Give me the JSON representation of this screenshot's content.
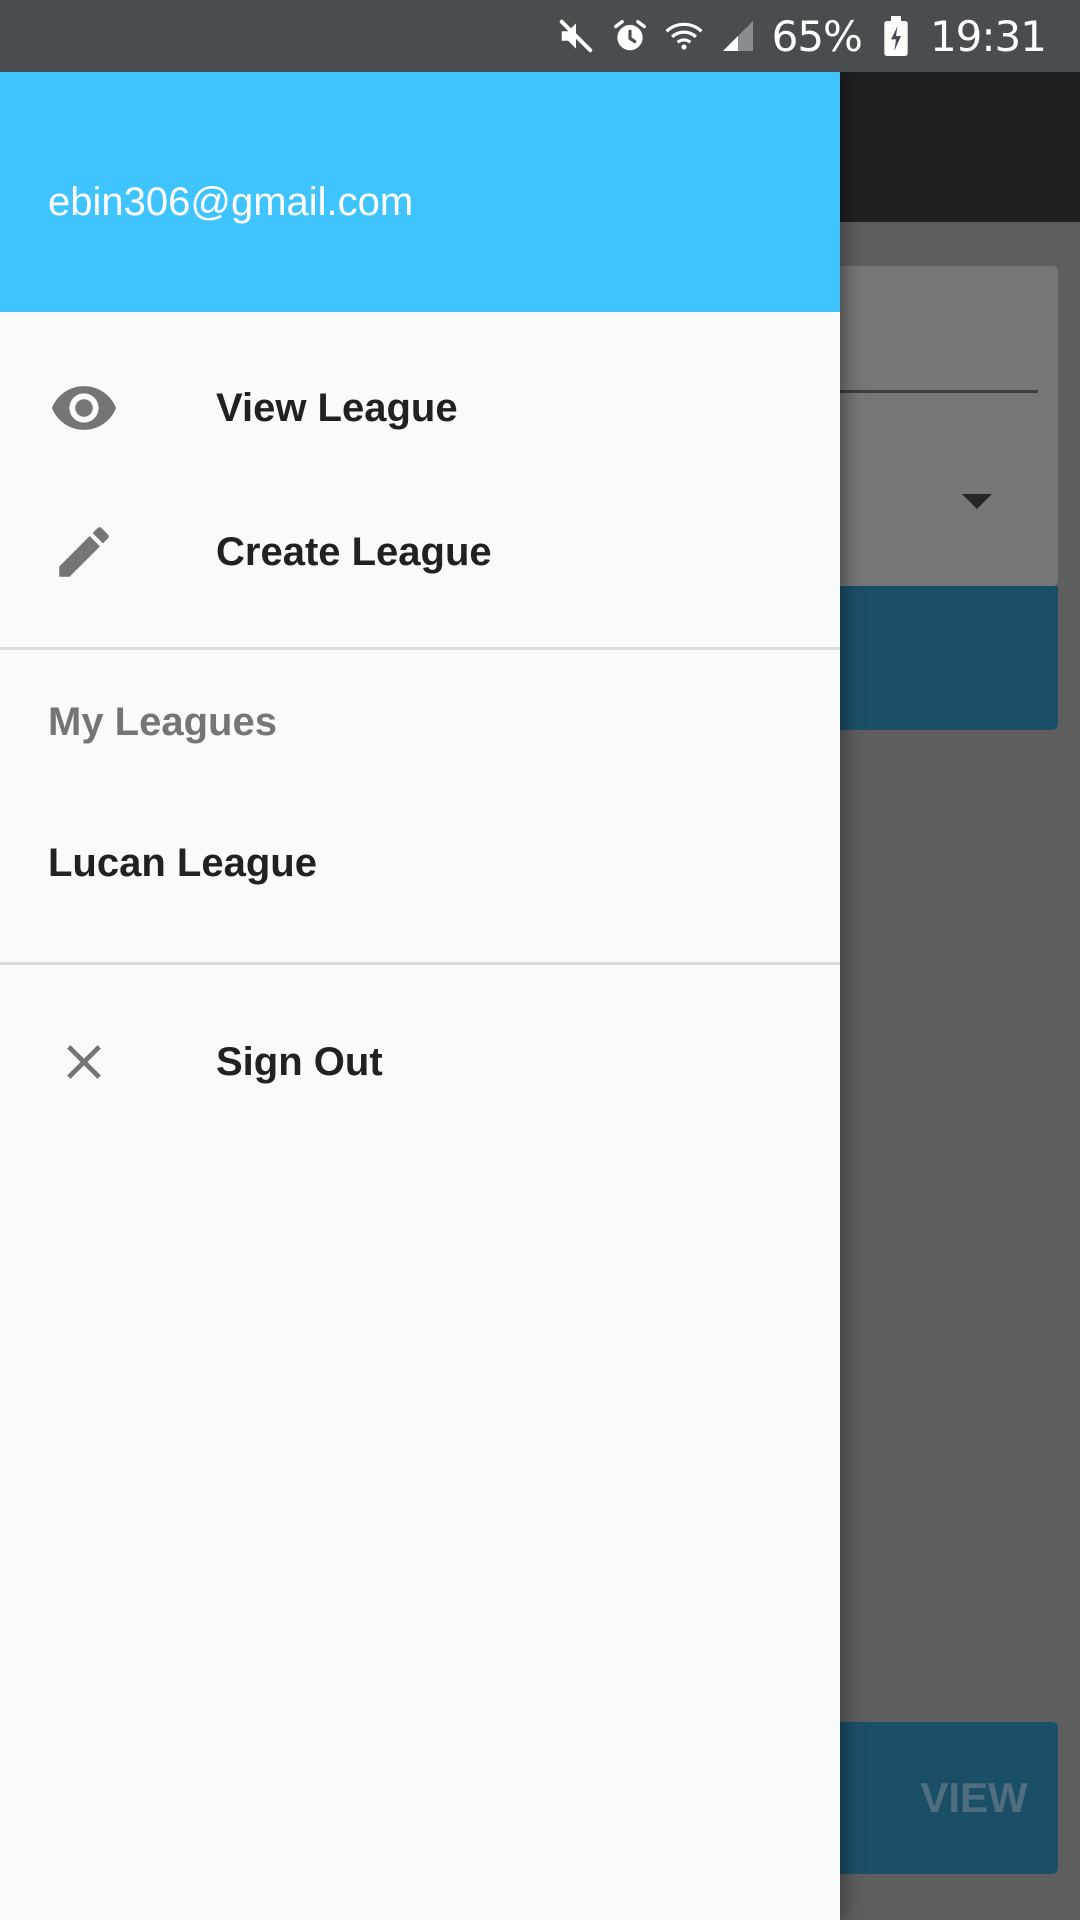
{
  "status_bar": {
    "battery": "65%",
    "time": "19:31",
    "icons": [
      "mute-icon",
      "alarm-icon",
      "wifi-icon",
      "signal-icon",
      "battery-charging-icon"
    ]
  },
  "drawer": {
    "header": {
      "email": "ebin306@gmail.com",
      "color": "#40c4ff"
    },
    "items": [
      {
        "label": "View League",
        "icon": "eye-icon"
      },
      {
        "label": "Create League",
        "icon": "pencil-icon"
      }
    ],
    "my_leagues": {
      "title": "My Leagues",
      "leagues": [
        {
          "label": "Lucan League"
        }
      ]
    },
    "sign_out": {
      "label": "Sign Out",
      "icon": "close-icon"
    }
  },
  "background_app": {
    "view_button_label": "VIEW",
    "accent_color": "#1b4f68"
  }
}
